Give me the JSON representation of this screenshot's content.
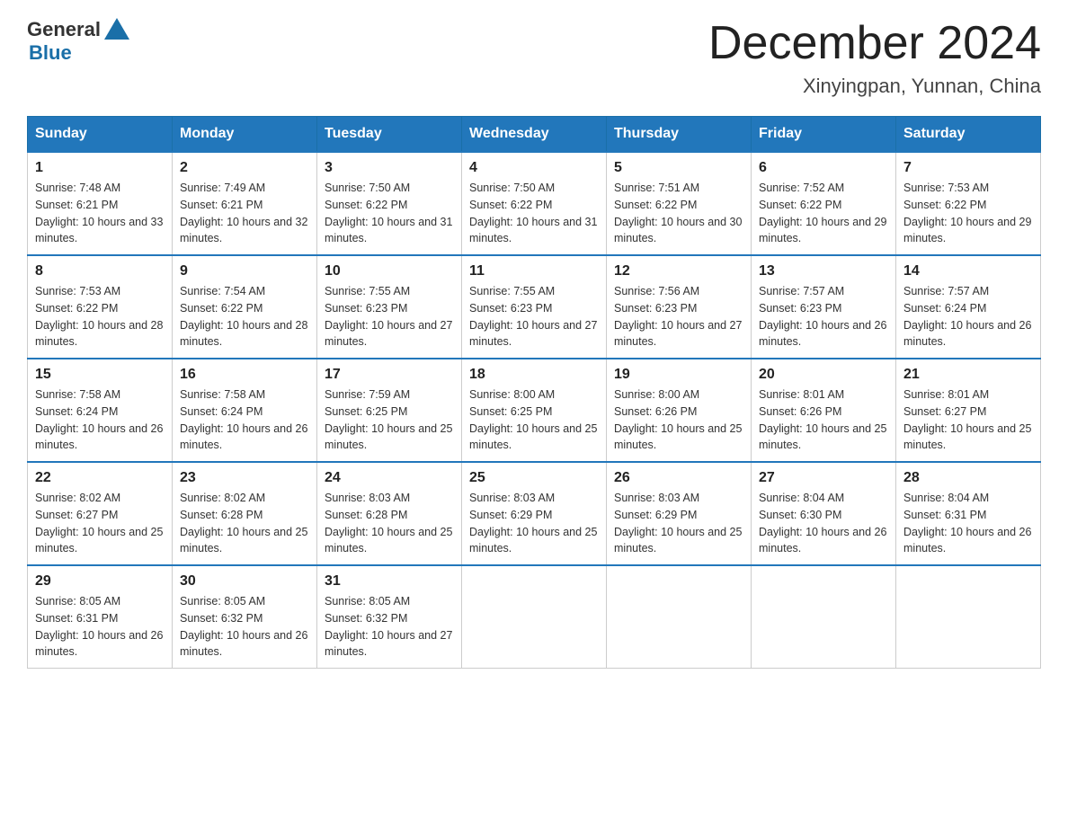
{
  "logo": {
    "general": "General",
    "blue": "Blue"
  },
  "header": {
    "title": "December 2024",
    "subtitle": "Xinyingpan, Yunnan, China"
  },
  "weekdays": [
    "Sunday",
    "Monday",
    "Tuesday",
    "Wednesday",
    "Thursday",
    "Friday",
    "Saturday"
  ],
  "weeks": [
    [
      {
        "day": "1",
        "sunrise": "7:48 AM",
        "sunset": "6:21 PM",
        "daylight": "10 hours and 33 minutes."
      },
      {
        "day": "2",
        "sunrise": "7:49 AM",
        "sunset": "6:21 PM",
        "daylight": "10 hours and 32 minutes."
      },
      {
        "day": "3",
        "sunrise": "7:50 AM",
        "sunset": "6:22 PM",
        "daylight": "10 hours and 31 minutes."
      },
      {
        "day": "4",
        "sunrise": "7:50 AM",
        "sunset": "6:22 PM",
        "daylight": "10 hours and 31 minutes."
      },
      {
        "day": "5",
        "sunrise": "7:51 AM",
        "sunset": "6:22 PM",
        "daylight": "10 hours and 30 minutes."
      },
      {
        "day": "6",
        "sunrise": "7:52 AM",
        "sunset": "6:22 PM",
        "daylight": "10 hours and 29 minutes."
      },
      {
        "day": "7",
        "sunrise": "7:53 AM",
        "sunset": "6:22 PM",
        "daylight": "10 hours and 29 minutes."
      }
    ],
    [
      {
        "day": "8",
        "sunrise": "7:53 AM",
        "sunset": "6:22 PM",
        "daylight": "10 hours and 28 minutes."
      },
      {
        "day": "9",
        "sunrise": "7:54 AM",
        "sunset": "6:22 PM",
        "daylight": "10 hours and 28 minutes."
      },
      {
        "day": "10",
        "sunrise": "7:55 AM",
        "sunset": "6:23 PM",
        "daylight": "10 hours and 27 minutes."
      },
      {
        "day": "11",
        "sunrise": "7:55 AM",
        "sunset": "6:23 PM",
        "daylight": "10 hours and 27 minutes."
      },
      {
        "day": "12",
        "sunrise": "7:56 AM",
        "sunset": "6:23 PM",
        "daylight": "10 hours and 27 minutes."
      },
      {
        "day": "13",
        "sunrise": "7:57 AM",
        "sunset": "6:23 PM",
        "daylight": "10 hours and 26 minutes."
      },
      {
        "day": "14",
        "sunrise": "7:57 AM",
        "sunset": "6:24 PM",
        "daylight": "10 hours and 26 minutes."
      }
    ],
    [
      {
        "day": "15",
        "sunrise": "7:58 AM",
        "sunset": "6:24 PM",
        "daylight": "10 hours and 26 minutes."
      },
      {
        "day": "16",
        "sunrise": "7:58 AM",
        "sunset": "6:24 PM",
        "daylight": "10 hours and 26 minutes."
      },
      {
        "day": "17",
        "sunrise": "7:59 AM",
        "sunset": "6:25 PM",
        "daylight": "10 hours and 25 minutes."
      },
      {
        "day": "18",
        "sunrise": "8:00 AM",
        "sunset": "6:25 PM",
        "daylight": "10 hours and 25 minutes."
      },
      {
        "day": "19",
        "sunrise": "8:00 AM",
        "sunset": "6:26 PM",
        "daylight": "10 hours and 25 minutes."
      },
      {
        "day": "20",
        "sunrise": "8:01 AM",
        "sunset": "6:26 PM",
        "daylight": "10 hours and 25 minutes."
      },
      {
        "day": "21",
        "sunrise": "8:01 AM",
        "sunset": "6:27 PM",
        "daylight": "10 hours and 25 minutes."
      }
    ],
    [
      {
        "day": "22",
        "sunrise": "8:02 AM",
        "sunset": "6:27 PM",
        "daylight": "10 hours and 25 minutes."
      },
      {
        "day": "23",
        "sunrise": "8:02 AM",
        "sunset": "6:28 PM",
        "daylight": "10 hours and 25 minutes."
      },
      {
        "day": "24",
        "sunrise": "8:03 AM",
        "sunset": "6:28 PM",
        "daylight": "10 hours and 25 minutes."
      },
      {
        "day": "25",
        "sunrise": "8:03 AM",
        "sunset": "6:29 PM",
        "daylight": "10 hours and 25 minutes."
      },
      {
        "day": "26",
        "sunrise": "8:03 AM",
        "sunset": "6:29 PM",
        "daylight": "10 hours and 25 minutes."
      },
      {
        "day": "27",
        "sunrise": "8:04 AM",
        "sunset": "6:30 PM",
        "daylight": "10 hours and 26 minutes."
      },
      {
        "day": "28",
        "sunrise": "8:04 AM",
        "sunset": "6:31 PM",
        "daylight": "10 hours and 26 minutes."
      }
    ],
    [
      {
        "day": "29",
        "sunrise": "8:05 AM",
        "sunset": "6:31 PM",
        "daylight": "10 hours and 26 minutes."
      },
      {
        "day": "30",
        "sunrise": "8:05 AM",
        "sunset": "6:32 PM",
        "daylight": "10 hours and 26 minutes."
      },
      {
        "day": "31",
        "sunrise": "8:05 AM",
        "sunset": "6:32 PM",
        "daylight": "10 hours and 27 minutes."
      },
      null,
      null,
      null,
      null
    ]
  ],
  "labels": {
    "sunrise": "Sunrise:",
    "sunset": "Sunset:",
    "daylight": "Daylight:"
  }
}
